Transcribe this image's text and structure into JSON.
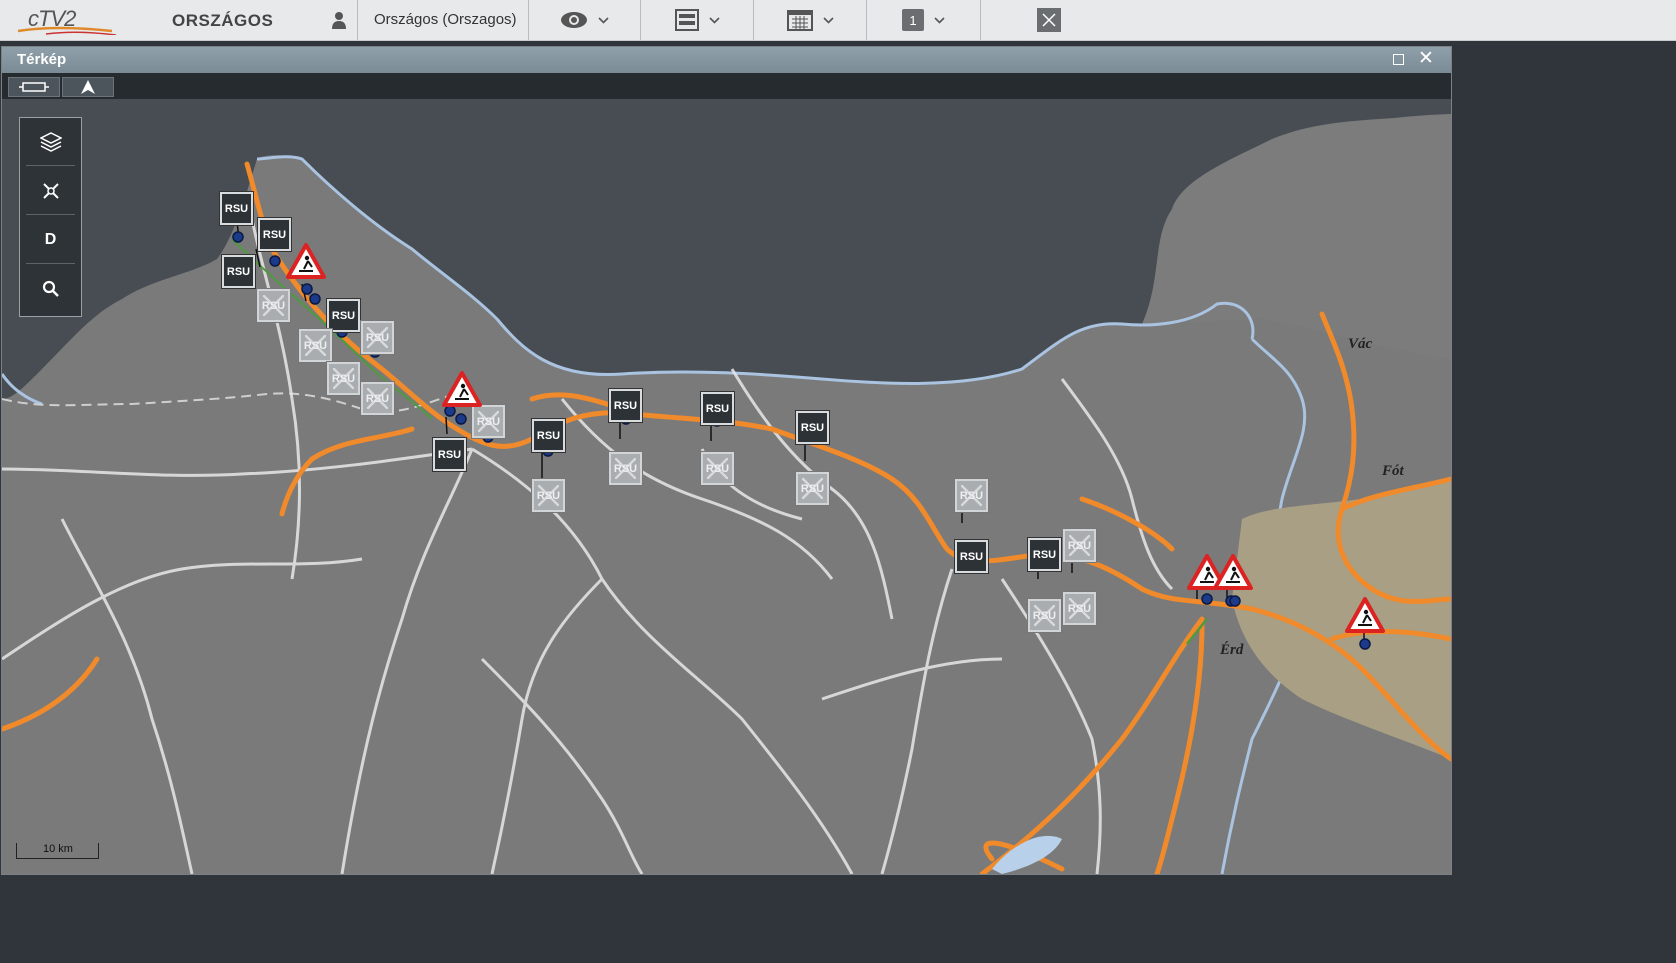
{
  "app": {
    "logo_text": "cTV2",
    "brand": "ORSZÁGOS",
    "user": "Országos (Orszagos)",
    "page_number": "1"
  },
  "window": {
    "title": "Térkép"
  },
  "map": {
    "side_menu": {
      "d_label": "D"
    },
    "rsu_label": "RSU",
    "place_labels": {
      "vac": "Vác",
      "fot": "Fót",
      "erd": "Érd"
    },
    "scale_label": "10 km"
  }
}
